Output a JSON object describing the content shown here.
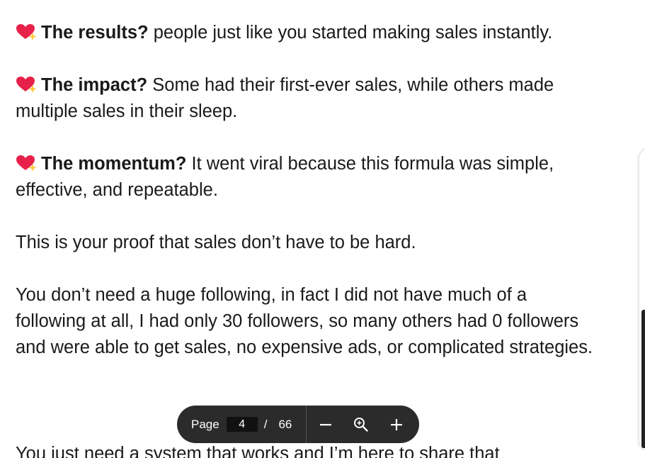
{
  "document": {
    "paragraphs": [
      {
        "lead": "The results?",
        "text": " people just like you started making sales instantly.",
        "heart": true
      },
      {
        "lead": "The impact?",
        "text": " Some had their first-ever sales, while others made multiple sales in their sleep.",
        "heart": true
      },
      {
        "lead": "The momentum?",
        "text": " It went viral because this formula was simple, effective, and repeatable.",
        "heart": true
      },
      {
        "lead": "",
        "text": "This is your proof that sales don’t have to be hard.",
        "heart": false
      },
      {
        "lead": "",
        "text": "You don’t need a huge following, in fact I did not have much of a following at all, I had only 30 followers, so many others had 0 followers and were able to get sales, no expensive ads, or complicated strategies.",
        "heart": false
      }
    ],
    "clipped_line": "You just need a system that works and I’m here to share that"
  },
  "toolbar": {
    "page_label": "Page",
    "current_page": "4",
    "separator": "/",
    "total_pages": "66"
  },
  "icons": {
    "bullet": "sparkling-heart-icon",
    "zoom_out": "minus-icon",
    "zoom_reset": "zoom-icon",
    "zoom_in": "plus-icon"
  },
  "colors": {
    "heart": "#e8214a",
    "sparkle": "#ffc83d",
    "toolbar_bg": "#2b2b2b"
  }
}
